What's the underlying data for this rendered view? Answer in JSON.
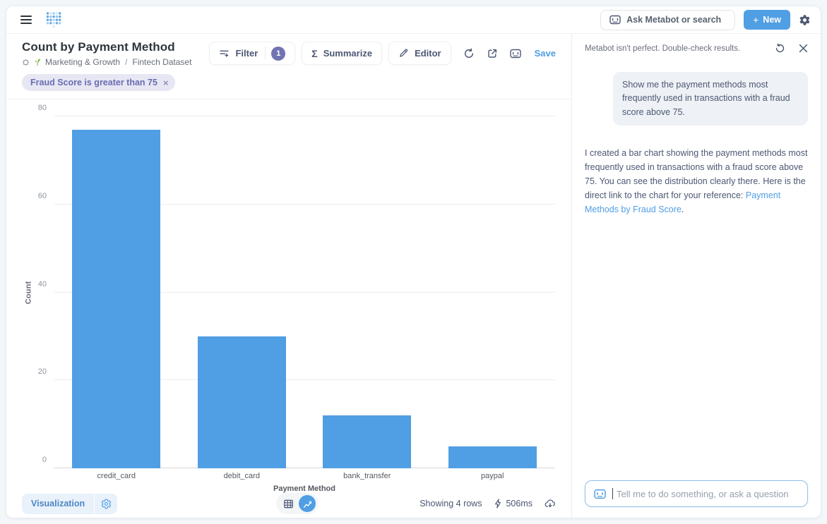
{
  "header": {
    "search_placeholder": "Ask Metabot or search",
    "new_label": "New"
  },
  "question": {
    "title": "Count by Payment Method",
    "breadcrumb": {
      "collection": "Marketing & Growth",
      "separator": "/",
      "dataset": "Fintech Dataset"
    },
    "filter_pill": "Fraud Score is greater than 75"
  },
  "toolbar": {
    "filter_label": "Filter",
    "filter_count": "1",
    "summarize_label": "Summarize",
    "sigma": "Σ",
    "editor_label": "Editor",
    "save_label": "Save"
  },
  "chart_data": {
    "type": "bar",
    "title": "Count by Payment Method",
    "categories": [
      "credit_card",
      "debit_card",
      "bank_transfer",
      "paypal"
    ],
    "values": [
      77,
      30,
      12,
      5
    ],
    "xlabel": "Payment Method",
    "ylabel": "Count",
    "ylim": [
      0,
      80
    ],
    "yticks": [
      0,
      20,
      40,
      60,
      80
    ],
    "bar_color": "#509EE3",
    "grid": "horizontal",
    "legend": "none"
  },
  "footer": {
    "visualization_label": "Visualization",
    "showing_text": "Showing 4 rows",
    "duration_text": "506ms"
  },
  "metabot": {
    "disclaimer": "Metabot isn't perfect. Double-check results.",
    "user_message": "Show me the payment methods most frequently used in transactions with a fraud score above 75.",
    "response": {
      "text_before_link": "I created a bar chart showing the payment methods most frequently used in transactions with a fraud score above 75. You can see the distribution clearly there. Here is the direct link to the chart for your reference: ",
      "link_text": "Payment Methods by Fraud Score",
      "text_after_link": "."
    },
    "input_placeholder": "Tell me to do something, or ask a question"
  },
  "colors": {
    "accent": "#509EE3",
    "filter_purple": "#6a6cb1",
    "badge_purple": "#7173b3",
    "link_blue": "#509EE3"
  }
}
